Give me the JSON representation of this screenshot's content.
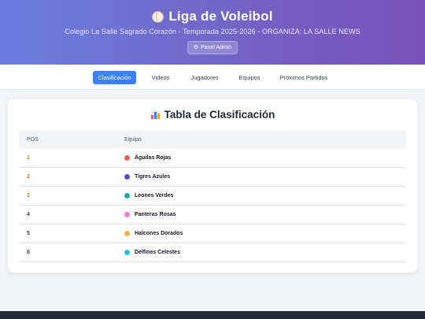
{
  "header": {
    "title": "Liga de Voleibol",
    "subtitle": "Colegio La Salle Sagrado Corazón - Temporada 2025-2026 - ORGANIZA: LA SALLE NEWS",
    "admin_button": "Panel Admin",
    "title_icon": "volleyball-icon",
    "admin_icon": "gear-icon"
  },
  "nav": {
    "tabs": [
      {
        "label": "Clasificación",
        "active": true
      },
      {
        "label": "Videos",
        "active": false
      },
      {
        "label": "Jugadores",
        "active": false
      },
      {
        "label": "Equipos",
        "active": false
      },
      {
        "label": "Próximos Partidos",
        "active": false
      }
    ]
  },
  "standings": {
    "title": "Tabla de Clasificación",
    "title_icon": "bar-chart-icon",
    "columns": [
      "POS",
      "Equipo"
    ],
    "rows": [
      {
        "pos": "1",
        "team": "Águilas Rojas",
        "color": "#e5625c"
      },
      {
        "pos": "2",
        "team": "Tigres Azules",
        "color": "#5a4fc0"
      },
      {
        "pos": "3",
        "team": "Leones Verdes",
        "color": "#1aa8a0"
      },
      {
        "pos": "4",
        "team": "Panteras Rosas",
        "color": "#ee7fd6"
      },
      {
        "pos": "5",
        "team": "Halcones Dorados",
        "color": "#f5b041"
      },
      {
        "pos": "6",
        "team": "Delfines Celestes",
        "color": "#22c4d8"
      }
    ]
  },
  "colors": {
    "accent": "#3b82f6",
    "top_positions": "#e8711a",
    "header_gradient_start": "#6a7fe0",
    "header_gradient_end": "#7a52b8"
  }
}
